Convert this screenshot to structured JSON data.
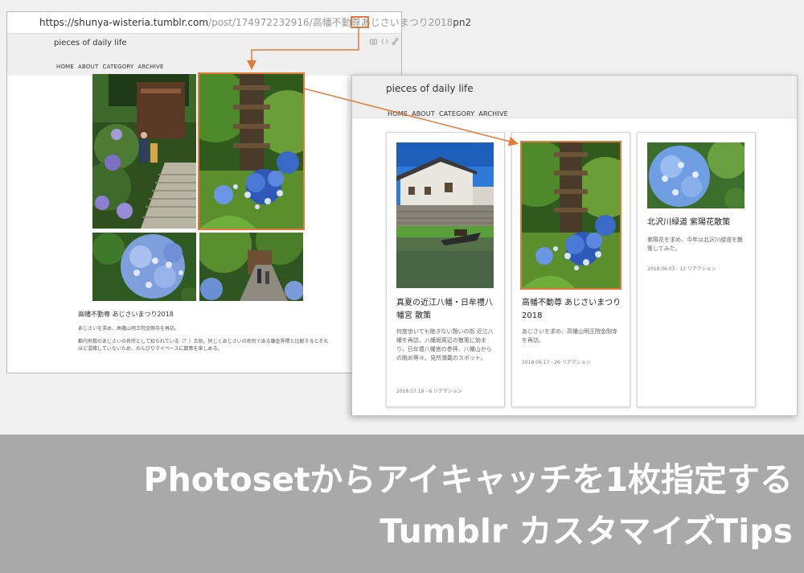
{
  "left_window": {
    "url_main": "https://shunya-wisteria.tumblr.com",
    "url_path": "/post/174972232916/高幡不動尊あじさいまつり2018",
    "url_highlight": "pn2",
    "blog_title": "pieces of daily life",
    "nav": [
      "HOME",
      "ABOUT",
      "CATEGORY",
      "ARCHIVE"
    ],
    "post_title": "高幡不動尊 あじさいまつり2018",
    "post_line1": "あじさいを求め、高幡山明王院金剛寺を再訪。",
    "post_line2": "都内有数のあじさいの名所として知られている（？）古刹。同じくあじさいの名所である鎌倉界隈と比較するとそれ",
    "post_line3": "ほど混雑していないため、のんびりマイペースに散策を楽しめる。"
  },
  "right_window": {
    "blog_title": "pieces of daily life",
    "nav": [
      "HOME",
      "ABOUT",
      "CATEGORY",
      "ARCHIVE"
    ],
    "cards": [
      {
        "title": "真夏の近江八幡・日牟禮八幡宮 散策",
        "desc": "何度歩いても飽きない憩いの街 近江八幡を再訪。八幡堀周辺の散策に始まり、日牟禮八幡宮の参拝、八幡山からの眺め等々。見所満載のスポット。",
        "meta": "2018.07.19 - 6 リアクション"
      },
      {
        "title": "高幡不動尊 あじさいまつり2018",
        "desc": "あじさいを求め、高幡山明王院金剛寺を再訪。",
        "meta": "2018.06.17 - 26 リアクション"
      },
      {
        "title": "北沢川緑道 紫陽花散策",
        "desc": "紫陽花を求め、今年は北沢川緑道を散策してみた。",
        "meta": "2018.06.03 - 13 リアクション"
      }
    ]
  },
  "banner": {
    "line1": "Photosetからアイキャッチを1枚指定する",
    "line2": "Tumblr カスタマイズTips"
  },
  "colors": {
    "highlight": "#e07b39",
    "banner_bg": "#a9a9a9",
    "page_bg": "#f1f1f1"
  },
  "icons": [
    "camera-icon",
    "code-icon",
    "link-icon",
    "arrow-icon"
  ]
}
